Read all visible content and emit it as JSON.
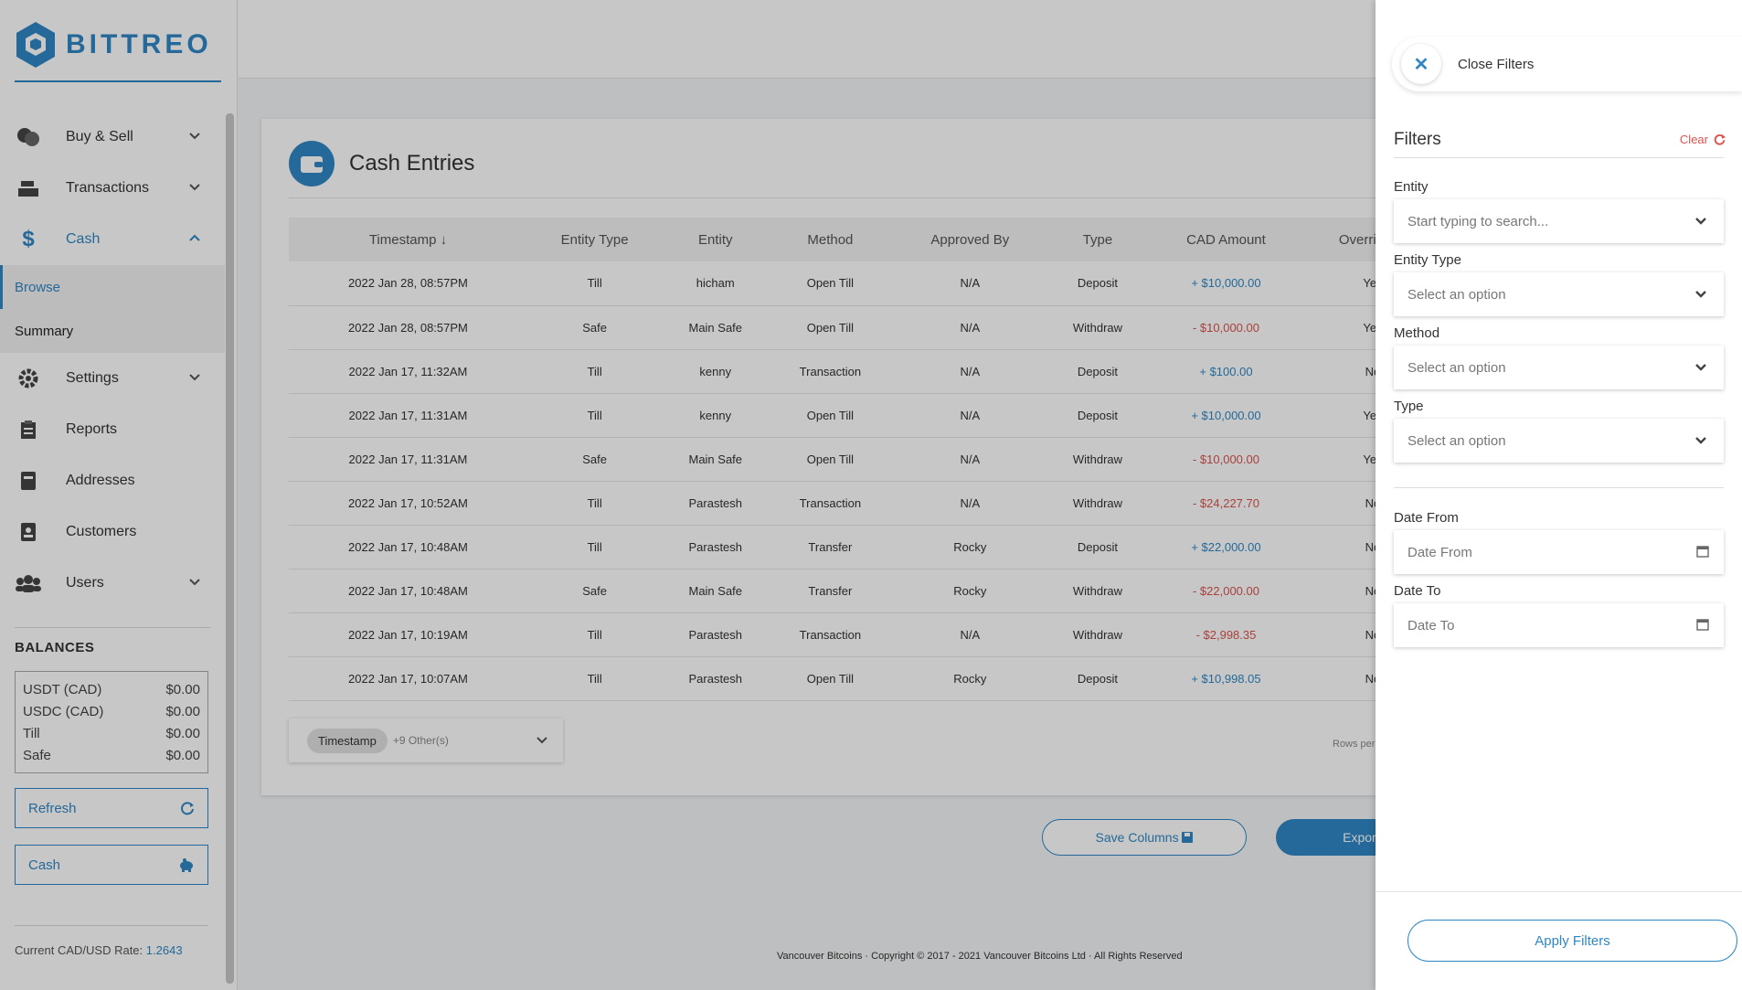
{
  "brand": {
    "name": "BITTREO",
    "color": "#2f87c4"
  },
  "sidebar": {
    "items": [
      {
        "label": "Buy & Sell",
        "icon": "coins-icon"
      },
      {
        "label": "Transactions",
        "icon": "cash-register-icon"
      },
      {
        "label": "Cash",
        "icon": "dollar-icon"
      },
      {
        "label": "Settings",
        "icon": "gear-icon"
      },
      {
        "label": "Reports",
        "icon": "clipboard-icon"
      },
      {
        "label": "Addresses",
        "icon": "address-book-icon"
      },
      {
        "label": "Customers",
        "icon": "id-badge-icon"
      },
      {
        "label": "Users",
        "icon": "users-icon"
      }
    ],
    "sub_items": [
      "Browse",
      "Summary"
    ],
    "balances_title": "BALANCES",
    "balances": [
      {
        "label": "USDT (CAD)",
        "value": "$0.00"
      },
      {
        "label": "USDC (CAD)",
        "value": "$0.00"
      },
      {
        "label": "Till",
        "value": "$0.00"
      },
      {
        "label": "Safe",
        "value": "$0.00"
      }
    ],
    "refresh_label": "Refresh",
    "cash_label": "Cash",
    "rate_label": "Current CAD/USD Rate:",
    "rate_value": "1.2643"
  },
  "main": {
    "title": "Cash Entries",
    "columns": [
      "Timestamp",
      "Entity Type",
      "Entity",
      "Method",
      "Approved By",
      "Type",
      "CAD Amount",
      "Overridden"
    ],
    "rows": [
      [
        "2022 Jan 28, 08:57PM",
        "Till",
        "hicham",
        "Open Till",
        "N/A",
        "Deposit",
        "+ $10,000.00",
        "Yes"
      ],
      [
        "2022 Jan 28, 08:57PM",
        "Safe",
        "Main Safe",
        "Open Till",
        "N/A",
        "Withdraw",
        "- $10,000.00",
        "Yes"
      ],
      [
        "2022 Jan 17, 11:32AM",
        "Till",
        "kenny",
        "Transaction",
        "N/A",
        "Deposit",
        "+ $100.00",
        "No"
      ],
      [
        "2022 Jan 17, 11:31AM",
        "Till",
        "kenny",
        "Open Till",
        "N/A",
        "Deposit",
        "+ $10,000.00",
        "Yes"
      ],
      [
        "2022 Jan 17, 11:31AM",
        "Safe",
        "Main Safe",
        "Open Till",
        "N/A",
        "Withdraw",
        "- $10,000.00",
        "Yes"
      ],
      [
        "2022 Jan 17, 10:52AM",
        "Till",
        "Parastesh",
        "Transaction",
        "N/A",
        "Withdraw",
        "- $24,227.70",
        "No"
      ],
      [
        "2022 Jan 17, 10:48AM",
        "Till",
        "Parastesh",
        "Transfer",
        "Rocky",
        "Deposit",
        "+ $22,000.00",
        "No"
      ],
      [
        "2022 Jan 17, 10:48AM",
        "Safe",
        "Main Safe",
        "Transfer",
        "Rocky",
        "Withdraw",
        "- $22,000.00",
        "No"
      ],
      [
        "2022 Jan 17, 10:19AM",
        "Till",
        "Parastesh",
        "Transaction",
        "N/A",
        "Withdraw",
        "- $2,998.35",
        "No"
      ],
      [
        "2022 Jan 17, 10:07AM",
        "Till",
        "Parastesh",
        "Open Till",
        "Rocky",
        "Deposit",
        "+ $10,998.05",
        "No"
      ]
    ],
    "column_chip": "Timestamp",
    "column_more": "+9 Other(s)",
    "rows_per_page": "Rows per",
    "save_columns": "Save Columns",
    "export": "Export S",
    "footer": "Vancouver Bitcoins · Copyright © 2017 - 2021 Vancouver Bitcoins Ltd · All Rights Reserved"
  },
  "filters": {
    "close_label": "Close Filters",
    "title": "Filters",
    "clear_label": "Clear",
    "entity_label": "Entity",
    "entity_placeholder": "Start typing to search...",
    "entity_type_label": "Entity Type",
    "entity_type_value": "Select an option",
    "method_label": "Method",
    "method_value": "Select an option",
    "type_label": "Type",
    "type_value": "Select an option",
    "date_from_label": "Date From",
    "date_from_placeholder": "Date From",
    "date_to_label": "Date To",
    "date_to_placeholder": "Date To",
    "apply_label": "Apply Filters"
  }
}
